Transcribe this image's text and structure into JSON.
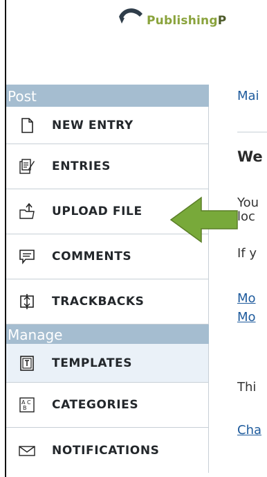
{
  "header": {
    "brand_part1": "Publishing",
    "brand_part2": "P"
  },
  "sidebar": {
    "post_title": "Post",
    "post_items": [
      {
        "label": "NEW ENTRY",
        "icon": "document-icon"
      },
      {
        "label": "ENTRIES",
        "icon": "entries-icon"
      },
      {
        "label": "UPLOAD FILE",
        "icon": "upload-icon"
      },
      {
        "label": "COMMENTS",
        "icon": "comment-icon"
      },
      {
        "label": "TRACKBACKS",
        "icon": "trackback-icon"
      }
    ],
    "manage_title": "Manage",
    "manage_items": [
      {
        "label": "TEMPLATES",
        "icon": "template-icon"
      },
      {
        "label": "CATEGORIES",
        "icon": "categories-icon"
      },
      {
        "label": "NOTIFICATIONS",
        "icon": "mail-icon"
      }
    ]
  },
  "content": {
    "link1": "Mai",
    "heading": "We",
    "line1": "You",
    "line2": "loc",
    "line3": "If y",
    "link2": "Mo",
    "link3": "Mo",
    "line4": "Thi",
    "link4": "Cha"
  },
  "colors": {
    "section_bg": "#a5bdd0",
    "arrow": "#78a93a",
    "link": "#1d5a9c"
  }
}
